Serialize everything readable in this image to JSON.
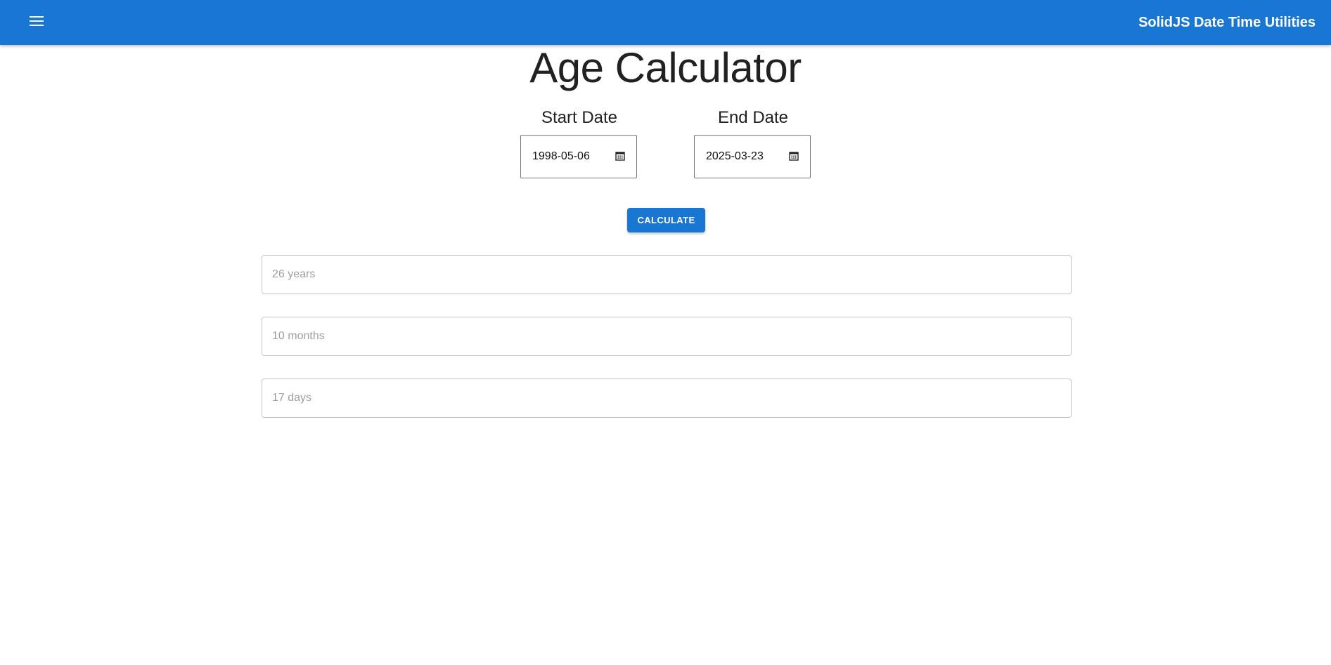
{
  "appbar": {
    "title": "SolidJS Date Time Utilities",
    "menu_icon": "menu-icon",
    "color": "#1976d2"
  },
  "page": {
    "title": "Age Calculator"
  },
  "start_date": {
    "label": "Start Date",
    "value": "1998-05-06",
    "icon": "calendar-icon"
  },
  "end_date": {
    "label": "End Date",
    "value": "2025-03-23",
    "icon": "calendar-icon"
  },
  "calculate_button": {
    "label": "CALCULATE"
  },
  "results": {
    "years": "26 years",
    "months": "10 months",
    "days": "17 days"
  }
}
